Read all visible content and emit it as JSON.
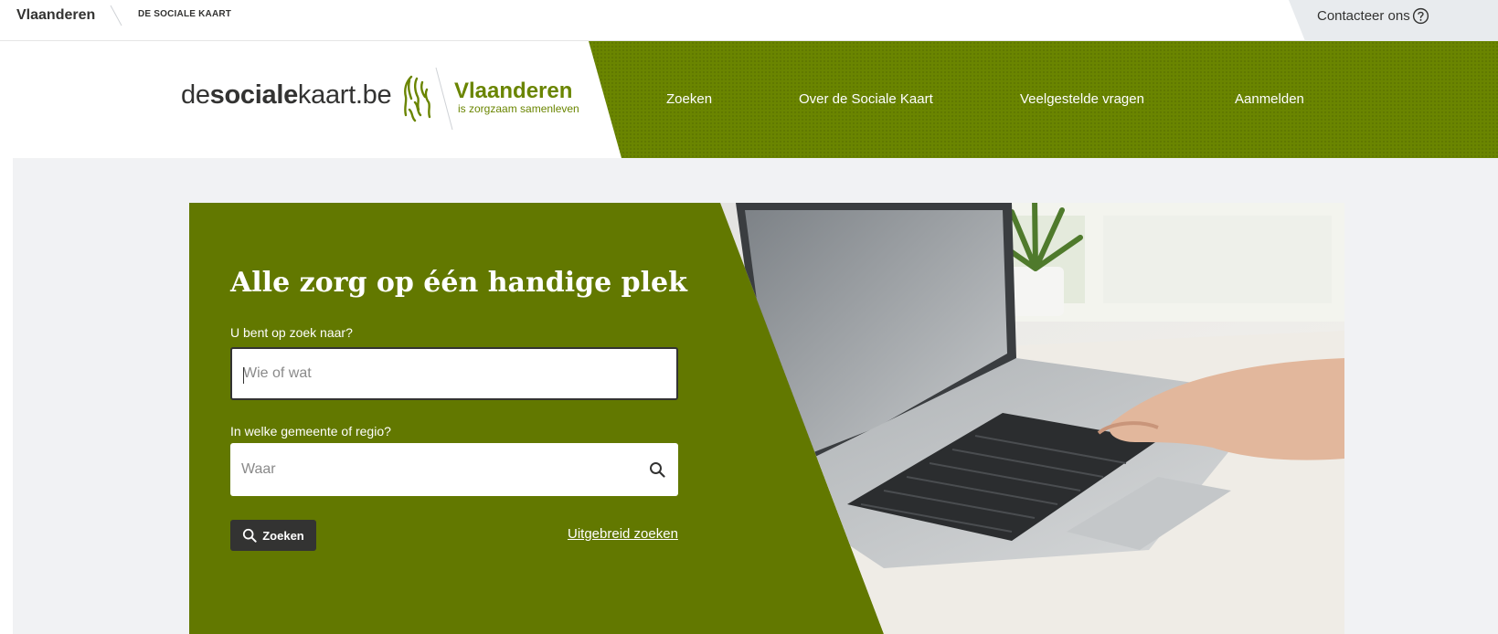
{
  "topbar": {
    "brand": "Vlaanderen",
    "site": "DE SOCIALE KAART",
    "contact": "Contacteer ons"
  },
  "header": {
    "logo_prefix": "de",
    "logo_bold": "sociale",
    "logo_suffix": "kaart.be",
    "vl_name": "Vlaanderen",
    "vl_tagline": "is zorgzaam samenleven",
    "nav": {
      "search": "Zoeken",
      "about": "Over de Sociale Kaart",
      "faq": "Veelgestelde vragen",
      "login": "Aanmelden"
    }
  },
  "hero": {
    "title": "Alle zorg op één handige plek",
    "what_label": "U bent op zoek naar?",
    "what_placeholder": "Wie of wat",
    "where_label": "In welke gemeente of regio?",
    "where_placeholder": "Waar",
    "search_button": "Zoeken",
    "advanced_link": "Uitgebreid zoeken"
  },
  "colors": {
    "green": "#6a8500",
    "hero_green": "#627800",
    "dark": "#333332"
  },
  "icons": {
    "contact": "help-circle-icon",
    "field": "search-icon",
    "button": "search-icon"
  }
}
